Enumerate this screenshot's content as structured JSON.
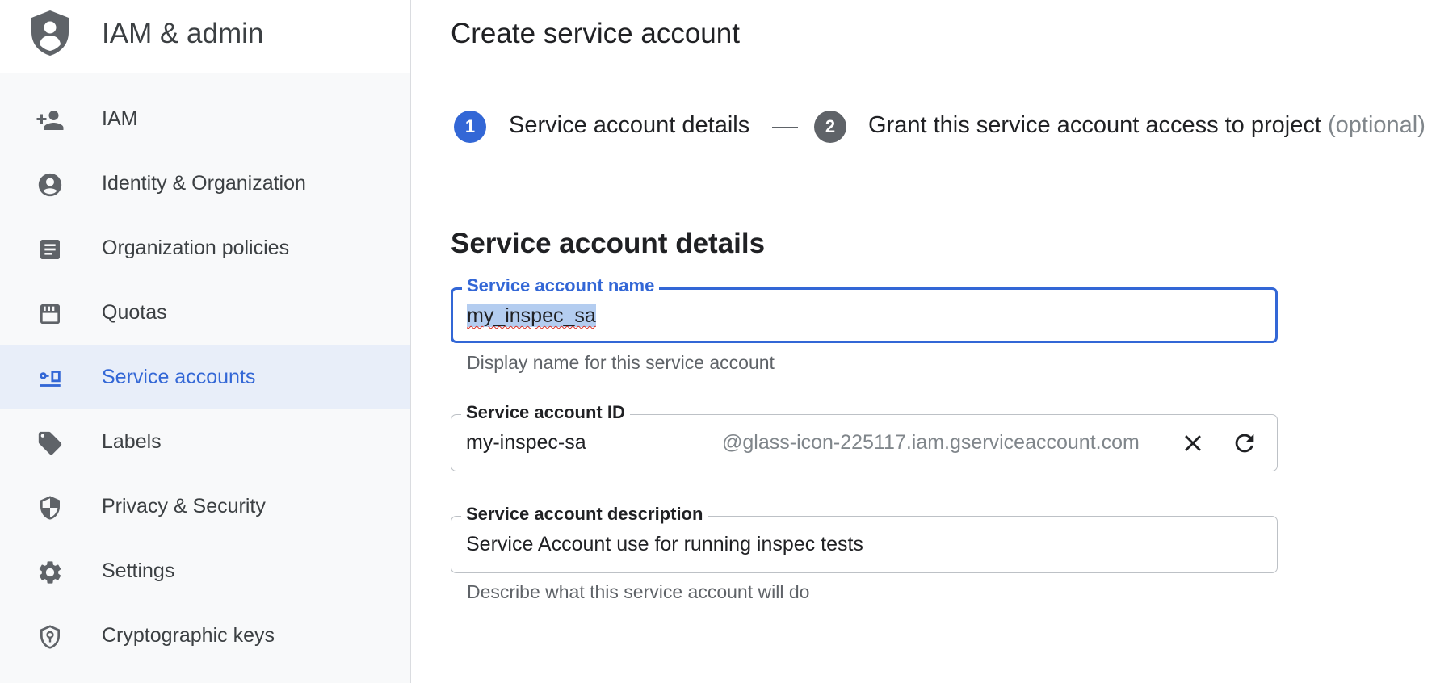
{
  "sidebar": {
    "title": "IAM & admin",
    "items": [
      {
        "label": "IAM",
        "icon": "person-add-icon"
      },
      {
        "label": "Identity & Organization",
        "icon": "account-circle-icon"
      },
      {
        "label": "Organization policies",
        "icon": "policy-document-icon"
      },
      {
        "label": "Quotas",
        "icon": "quota-icon"
      },
      {
        "label": "Service accounts",
        "icon": "service-account-icon",
        "active": true
      },
      {
        "label": "Labels",
        "icon": "label-tag-icon"
      },
      {
        "label": "Privacy & Security",
        "icon": "shield-icon"
      },
      {
        "label": "Settings",
        "icon": "gear-icon"
      },
      {
        "label": "Cryptographic keys",
        "icon": "key-shield-icon"
      }
    ]
  },
  "header": {
    "title": "Create service account"
  },
  "stepper": {
    "steps": [
      {
        "number": "1",
        "label": "Service account details"
      },
      {
        "number": "2",
        "label": "Grant this service account access to project",
        "optional": "(optional)"
      }
    ]
  },
  "form": {
    "section_title": "Service account details",
    "name": {
      "label": "Service account name",
      "value": "my_inspec_sa",
      "helper": "Display name for this service account"
    },
    "id": {
      "label": "Service account ID",
      "value": "my-inspec-sa",
      "suffix": "@glass-icon-225117.iam.gserviceaccount.com"
    },
    "description": {
      "label": "Service account description",
      "value": "Service Account use for running inspec tests",
      "helper": "Describe what this service account will do"
    }
  },
  "colors": {
    "accent": "#3367d6",
    "active_bg": "#e8eef9",
    "icon_gray": "#5f6368"
  }
}
